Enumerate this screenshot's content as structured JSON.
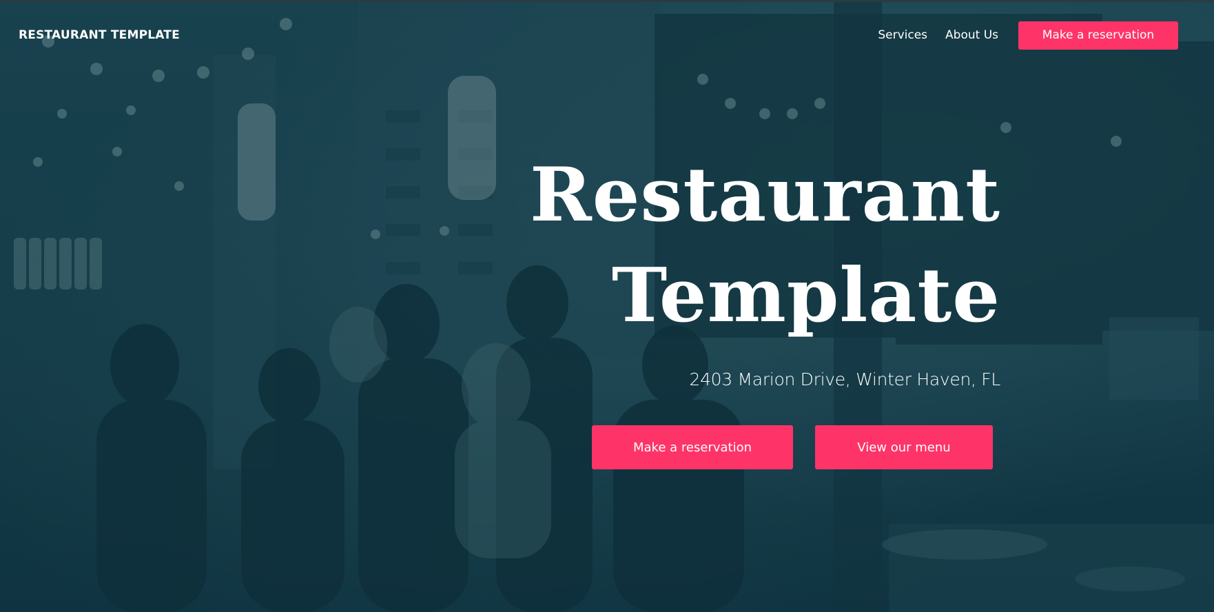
{
  "brand": {
    "name": "RESTAURANT TEMPLATE"
  },
  "nav": {
    "links": [
      {
        "label": "Services"
      },
      {
        "label": "About Us"
      }
    ],
    "cta_label": "Make a reservation"
  },
  "hero": {
    "title_line1": "Restaurant",
    "title_line2": "Template",
    "address": "2403 Marion Drive, Winter Haven, FL",
    "buttons": {
      "reserve_label": "Make a reservation",
      "menu_label": "View our menu"
    }
  },
  "colors": {
    "accent": "#fe3468",
    "overlay": "#0f3442",
    "text": "#ffffff"
  }
}
